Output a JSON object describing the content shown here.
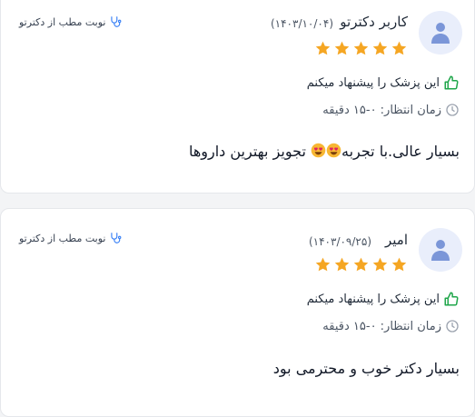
{
  "colors": {
    "star": "#f5a623",
    "thumb": "#1fa64a",
    "avatar_bg": "#e9eefb",
    "avatar_fg": "#7b96d8",
    "stethoscope": "#3b82f6"
  },
  "reviews": [
    {
      "user_name": "کاربر دکترتو",
      "date": "(۱۴۰۳/۱۰/۰۴)",
      "rating": 5,
      "recommend_text": "این پزشک را پیشنهاد میکنم",
      "wait_time": "زمان انتظار: ۰-۱۵ دقیقه",
      "source_label": "نوبت مطب از دکترتو",
      "comment_before": "بسیار عالی.با تجربه",
      "comment_after": "تجویز بهترین داروها",
      "comment_emoji_count": 2
    },
    {
      "user_name": "امیر",
      "date": "(۱۴۰۳/۰۹/۲۵)",
      "rating": 5,
      "recommend_text": "این پزشک را پیشنهاد میکنم",
      "wait_time": "زمان انتظار: ۰-۱۵ دقیقه",
      "source_label": "نوبت مطب از دکترتو",
      "comment": "بسیار دکتر خوب و محترمی بود"
    }
  ]
}
